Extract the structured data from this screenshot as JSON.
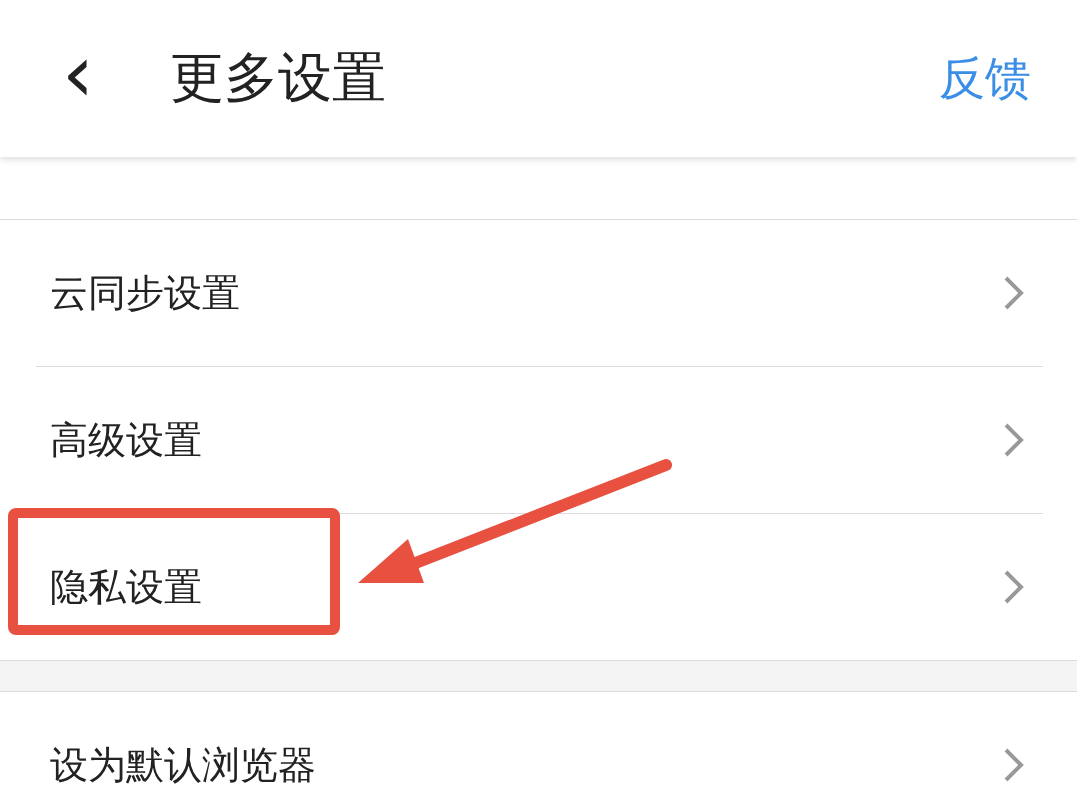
{
  "header": {
    "back_icon": "‹",
    "title": "更多设置",
    "action": "反馈"
  },
  "sections": [
    {
      "rows": [
        {
          "label": "云同步设置",
          "highlighted": false
        },
        {
          "label": "高级设置",
          "highlighted": false
        },
        {
          "label": "隐私设置",
          "highlighted": true
        }
      ]
    },
    {
      "rows": [
        {
          "label": "设为默认浏览器",
          "highlighted": false
        }
      ]
    }
  ]
}
